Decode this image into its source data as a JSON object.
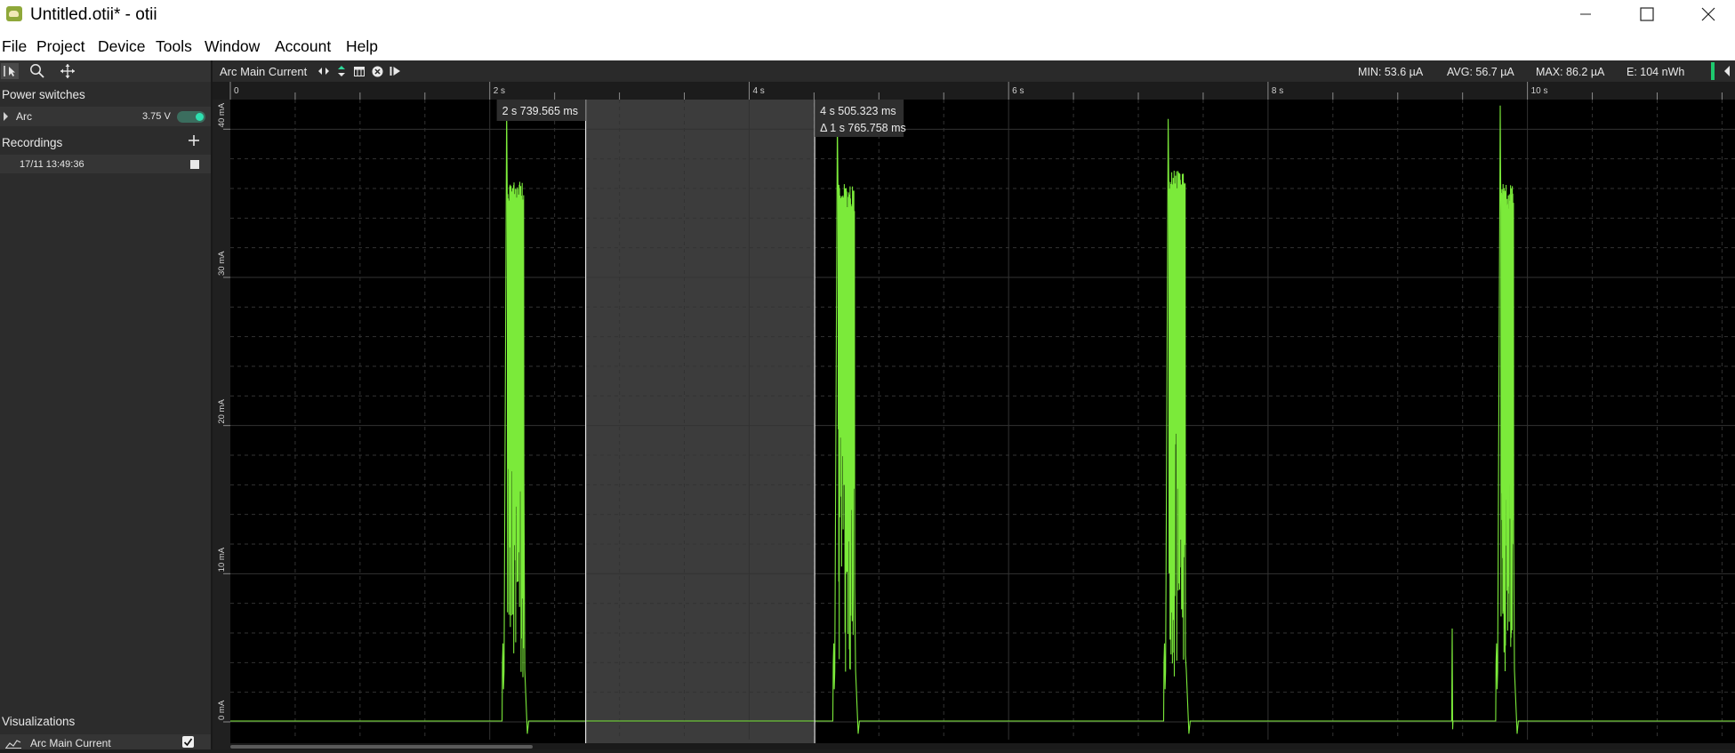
{
  "window": {
    "title": "Untitled.otii* - otii",
    "icon": "otii-app-icon",
    "controls": [
      "minimize-icon",
      "maximize-icon",
      "close-icon"
    ]
  },
  "menu": [
    "File",
    "Project",
    "Device",
    "Tools",
    "Window",
    "Account",
    "Help"
  ],
  "sidebar": {
    "tools": [
      "select-cursor-icon",
      "zoom-icon",
      "pan-icon"
    ],
    "power_switches": {
      "heading": "Power switches",
      "items": [
        {
          "name": "Arc",
          "voltage": "3.75 V",
          "enabled": true
        }
      ]
    },
    "recordings": {
      "heading": "Recordings",
      "items": [
        {
          "name": "17/11 13:49:36"
        }
      ]
    },
    "visualizations": {
      "heading": "Visualizations",
      "items": [
        {
          "name": "Arc Main Current",
          "checked": true
        }
      ]
    }
  },
  "chart_header": {
    "title": "Arc Main Current",
    "icons": [
      "expand-horizontal-icon",
      "expand-vertical-icon",
      "table-icon",
      "close-circle-icon",
      "play-to-end-icon"
    ],
    "stats": {
      "min": "MIN: 53.6 µA",
      "avg": "AVG: 56.7 µA",
      "max": "MAX: 86.2 µA",
      "energy": "E: 104 nWh"
    }
  },
  "colors": {
    "trace": "#7bea3a",
    "background": "#000000",
    "selection": "#3c3c3c",
    "accent": "#1ec96e"
  },
  "chart_data": {
    "type": "line",
    "title": "Arc Main Current",
    "x_unit": "s",
    "xlim": [
      0,
      11.6
    ],
    "x_ticks": [
      "0",
      "2 s",
      "4 s",
      "6 s",
      "8 s",
      "10 s"
    ],
    "y_ticks": [
      "0 mA",
      "10 mA",
      "20 mA",
      "30 mA",
      "40 mA"
    ],
    "ylim": [
      -1.2,
      42
    ],
    "baseline_mA": 0.057,
    "bursts": [
      {
        "start_s": 2.11,
        "end_s": 2.29,
        "peak_mA": 41.7,
        "plateau_mA": 36.5
      },
      {
        "start_s": 4.66,
        "end_s": 4.84,
        "peak_mA": 40.8,
        "plateau_mA": 36.4
      },
      {
        "start_s": 7.21,
        "end_s": 7.39,
        "peak_mA": 40.7,
        "plateau_mA": 37.2
      },
      {
        "start_s": 9.77,
        "end_s": 9.92,
        "peak_mA": 41.6,
        "plateau_mA": 36.3
      }
    ],
    "minor_spike": {
      "x_s": 9.42,
      "peak_mA": 6.3
    },
    "cursors": [
      {
        "x_s": 2.739565,
        "label": "2 s 739.565 ms"
      },
      {
        "x_s": 4.505323,
        "label": "4 s 505.323 ms",
        "delta": "Δ 1 s 765.758 ms"
      }
    ],
    "grid": true
  }
}
